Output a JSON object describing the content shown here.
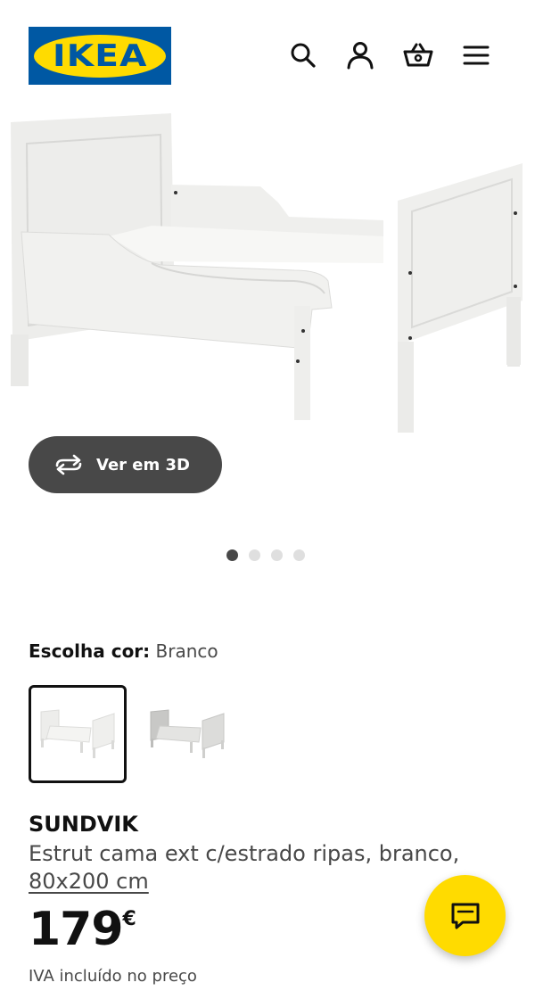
{
  "header": {
    "logo_text": "IKEA",
    "icons": [
      "search-icon",
      "user-icon",
      "basket-icon",
      "menu-icon"
    ]
  },
  "gallery": {
    "view_3d_label": "Ver em 3D",
    "slide_count": 4,
    "active_slide": 1
  },
  "color_picker": {
    "label": "Escolha cor:",
    "selected_value": "Branco",
    "swatches": [
      "white",
      "grey"
    ]
  },
  "product": {
    "name": "SUNDVIK",
    "description": "Estrut cama ext c/estrado ripas, branco,",
    "size": "80x200 cm",
    "price": "179",
    "currency": "€",
    "vat_note": "IVA incluído no preço"
  },
  "colors": {
    "brand_blue": "#0058a3",
    "brand_yellow": "#ffdb00",
    "button_dark": "#484848"
  }
}
